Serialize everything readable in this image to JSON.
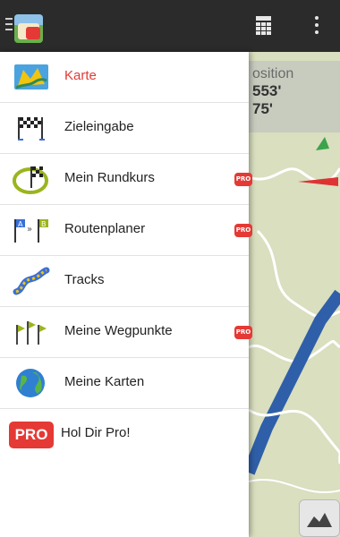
{
  "topbar": {
    "icons": [
      "drawer-toggle-icon",
      "app-logo-icon",
      "calculator-icon",
      "more-vert-icon"
    ]
  },
  "map_overlay": {
    "position_label": "osition",
    "coord_1": "553'",
    "coord_2": "75'"
  },
  "drawer": {
    "items": [
      {
        "label": "Karte",
        "icon": "map-icon",
        "active": true,
        "pro": false
      },
      {
        "label": "Zieleingabe",
        "icon": "checkered-flag-icon",
        "active": false,
        "pro": false
      },
      {
        "label": "Mein Rundkurs",
        "icon": "round-course-icon",
        "active": false,
        "pro": true
      },
      {
        "label": "Routenplaner",
        "icon": "route-planner-icon",
        "active": false,
        "pro": true
      },
      {
        "label": "Tracks",
        "icon": "tracks-icon",
        "active": false,
        "pro": false
      },
      {
        "label": "Meine Wegpunkte",
        "icon": "waypoints-icon",
        "active": false,
        "pro": true
      },
      {
        "label": "Meine Karten",
        "icon": "globe-icon",
        "active": false,
        "pro": false
      }
    ],
    "pro_badge_text": "PRO",
    "promo": {
      "logo_text": "PRO",
      "label": "Hol Dir Pro!"
    }
  },
  "colors": {
    "accent": "#e53935",
    "topbar": "#2b2b2b",
    "map_bg": "#dfe3c6"
  }
}
